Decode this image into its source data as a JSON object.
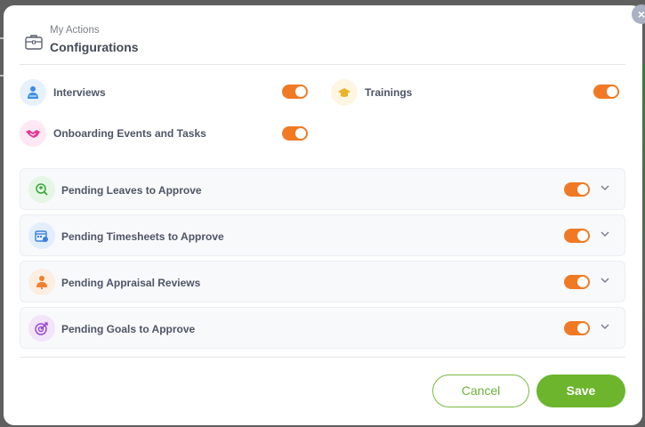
{
  "header": {
    "subtitle": "My Actions",
    "title": "Configurations"
  },
  "colors": {
    "toggle_on": "#f07a24",
    "save_bg": "#6cb52c",
    "cancel_border": "#7bb93e"
  },
  "top_items": [
    {
      "label": "Interviews",
      "icon": "interview-person-icon",
      "enabled": true
    },
    {
      "label": "Trainings",
      "icon": "graduation-cap-icon",
      "enabled": true
    },
    {
      "label": "Onboarding Events and Tasks",
      "icon": "handshake-icon",
      "enabled": true
    }
  ],
  "cards": [
    {
      "label": "Pending Leaves to Approve",
      "icon": "leave-calendar-icon",
      "enabled": true
    },
    {
      "label": "Pending Timesheets to Approve",
      "icon": "timesheet-calendar-icon",
      "enabled": true
    },
    {
      "label": "Pending Appraisal Reviews",
      "icon": "appraisal-person-icon",
      "enabled": true
    },
    {
      "label": "Pending Goals to Approve",
      "icon": "target-icon",
      "enabled": true
    }
  ],
  "footer": {
    "cancel_label": "Cancel",
    "save_label": "Save"
  },
  "close_label": "×"
}
